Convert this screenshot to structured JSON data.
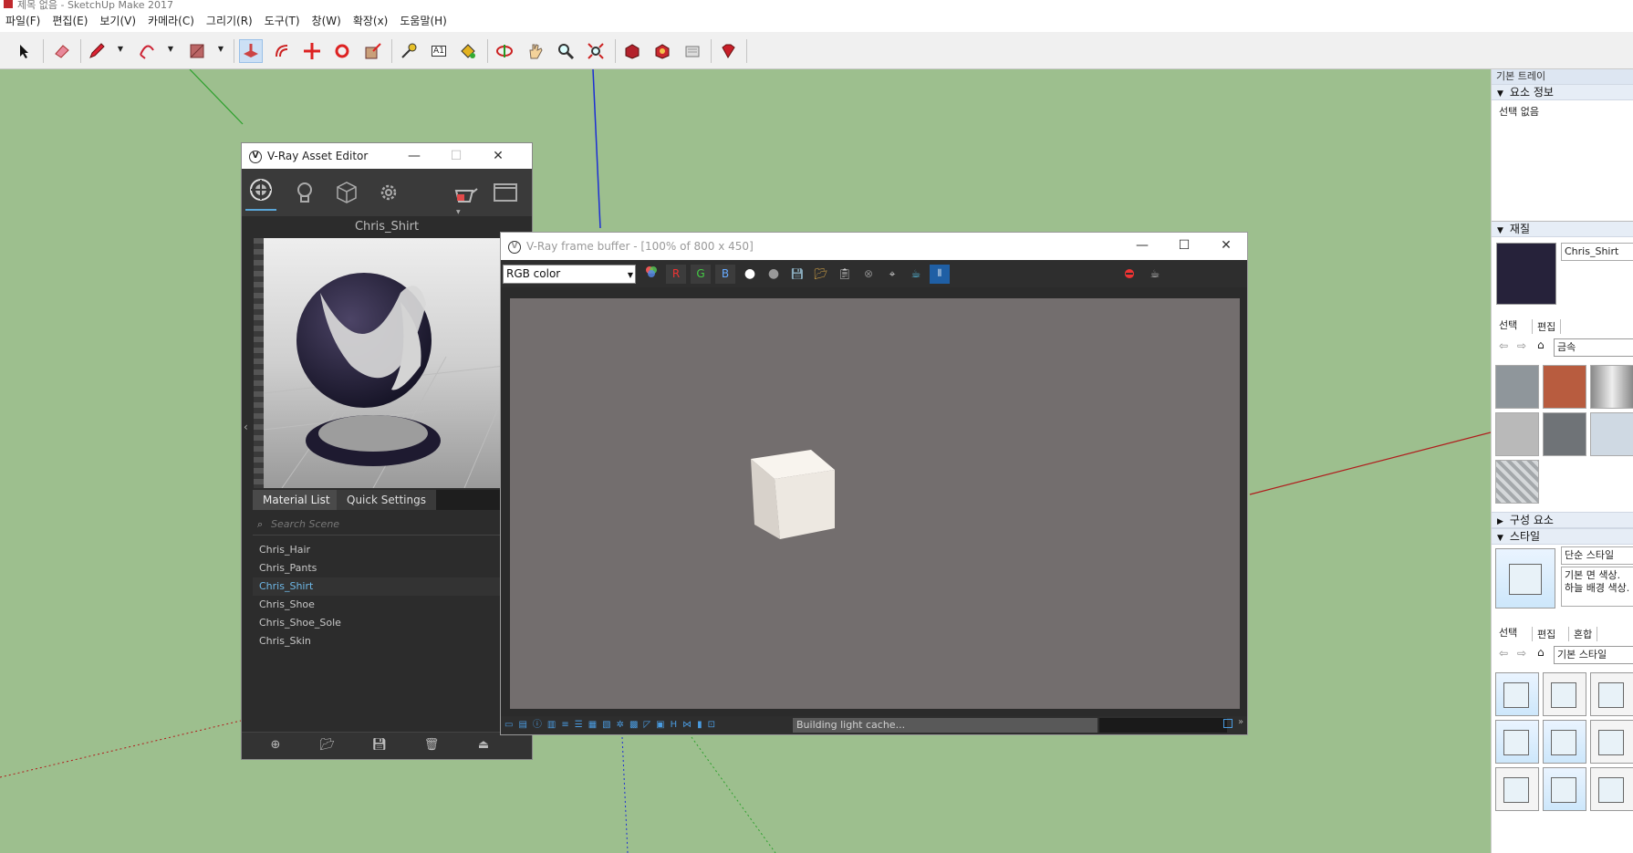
{
  "window": {
    "title": "제목 없음 - SketchUp Make 2017"
  },
  "menu": [
    "파일(F)",
    "편집(E)",
    "보기(V)",
    "카메라(C)",
    "그리기(R)",
    "도구(T)",
    "창(W)",
    "확장(x)",
    "도움말(H)"
  ],
  "toolbar": {
    "tools": [
      "select-tool",
      "eraser-tool",
      "pencil-tool",
      "arc-tool",
      "rectangle-tool",
      "push-pull-tool",
      "offset-tool",
      "move-tool",
      "rotate-tool",
      "scale-tool",
      "tape-measure-tool",
      "text-tool",
      "paint-bucket-tool",
      "orbit-tool",
      "pan-tool",
      "zoom-tool",
      "zoom-extents-tool",
      "warehouse-tool",
      "extension-warehouse-tool",
      "layout-tool",
      "ruby-tool"
    ],
    "active": "push-pull-tool",
    "text_tool_glyph": "A1"
  },
  "tray": {
    "title": "기본 트레이",
    "entity_info": {
      "header": "요소 정보",
      "text": "선택 없음"
    },
    "materials": {
      "header": "재질",
      "name": "Chris_Shirt",
      "swatch_color": "#26223a",
      "tabs": [
        "선택",
        "편집"
      ],
      "library": "금속",
      "thumbs": [
        "#8f969b",
        "#b85c3f",
        "#c8c8c8",
        "#b9b9b9",
        "#6f7377",
        "#cfd9e3",
        "#a4a8ab"
      ]
    },
    "components": {
      "header": "구성 요소"
    },
    "styles": {
      "header": "스타일",
      "name": "단순 스타일",
      "description": "기본 면 색상. 하늘 배경 색상.",
      "tabs": [
        "선택",
        "편집",
        "혼합"
      ],
      "library": "기본 스타일"
    }
  },
  "asset_editor": {
    "title": "V-Ray Asset Editor",
    "categories": [
      "materials",
      "lights",
      "geometry",
      "settings"
    ],
    "material_name": "Chris_Shirt",
    "tabs": [
      "Material List",
      "Quick Settings"
    ],
    "search_placeholder": "Search Scene",
    "materials": [
      "Chris_Hair",
      "Chris_Pants",
      "Chris_Shirt",
      "Chris_Shoe",
      "Chris_Shoe_Sole",
      "Chris_Skin"
    ],
    "selected_material": "Chris_Shirt",
    "footer_actions": [
      "add-asset",
      "open-file",
      "save-file",
      "delete",
      "purge"
    ]
  },
  "vfb": {
    "title": "V-Ray frame buffer - [100% of 800 x 450]",
    "channel": "RGB color",
    "channel_buttons": [
      "R",
      "G",
      "B"
    ],
    "status": "Building light cache...",
    "status_letter": "H",
    "render_bg": "#736e6e"
  }
}
